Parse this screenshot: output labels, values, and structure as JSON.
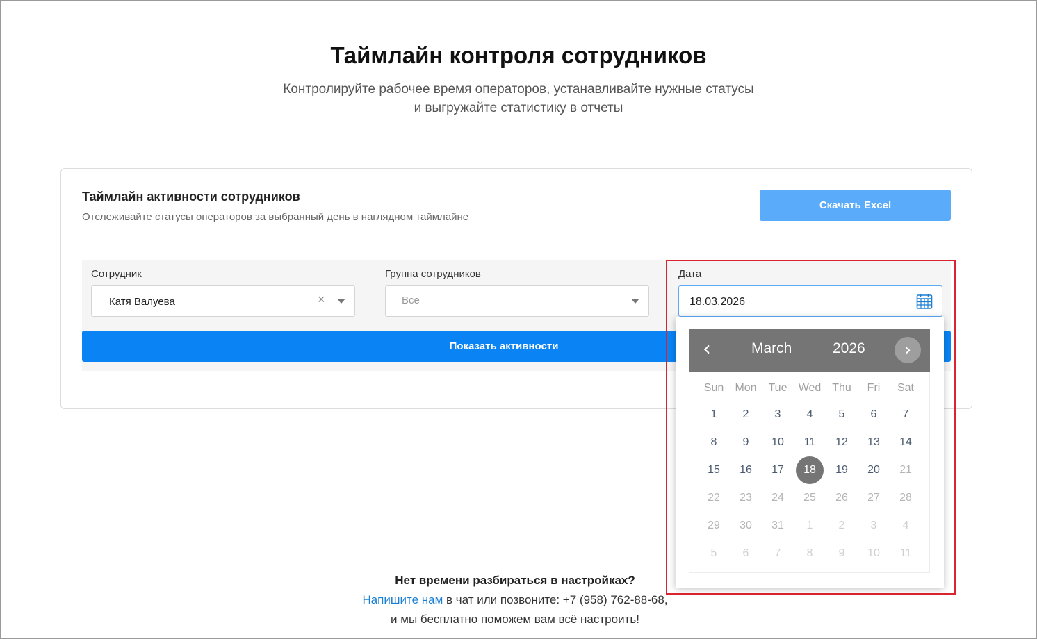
{
  "header": {
    "title": "Таймлайн контроля сотрудников",
    "subtitle_line1": "Контролируйте рабочее время операторов, устанавливайте нужные статусы",
    "subtitle_line2": "и выгружайте статистику в отчеты"
  },
  "card": {
    "title": "Таймлайн активности сотрудников",
    "description": "Отслеживайте статусы операторов за выбранный день в наглядном таймлайне",
    "excel_button": "Скачать Excel",
    "show_button": "Показать активности"
  },
  "filters": {
    "employee_label": "Сотрудник",
    "employee_value": "Катя Валуева",
    "clear_glyph": "×",
    "group_label": "Группа сотрудников",
    "group_value": "Все",
    "date_label": "Дата",
    "date_value": "18.03.2026"
  },
  "datepicker": {
    "prev_glyph": "‹",
    "next_glyph": "›",
    "month": "March",
    "year": "2026",
    "weekdays": [
      "Sun",
      "Mon",
      "Tue",
      "Wed",
      "Thu",
      "Fri",
      "Sat"
    ],
    "selected_day": 18,
    "days": [
      [
        {
          "d": "1",
          "s": "past"
        },
        {
          "d": "2",
          "s": "past"
        },
        {
          "d": "3",
          "s": "past"
        },
        {
          "d": "4",
          "s": "past"
        },
        {
          "d": "5",
          "s": "past"
        },
        {
          "d": "6",
          "s": "past"
        },
        {
          "d": "7",
          "s": "past"
        }
      ],
      [
        {
          "d": "8",
          "s": "past"
        },
        {
          "d": "9",
          "s": "past"
        },
        {
          "d": "10",
          "s": "past"
        },
        {
          "d": "11",
          "s": "past"
        },
        {
          "d": "12",
          "s": "past"
        },
        {
          "d": "13",
          "s": "past"
        },
        {
          "d": "14",
          "s": "past"
        }
      ],
      [
        {
          "d": "15",
          "s": "past"
        },
        {
          "d": "16",
          "s": "past"
        },
        {
          "d": "17",
          "s": "past"
        },
        {
          "d": "18",
          "s": "selected"
        },
        {
          "d": "19",
          "s": "past"
        },
        {
          "d": "20",
          "s": "past"
        },
        {
          "d": "21",
          "s": "future"
        }
      ],
      [
        {
          "d": "22",
          "s": "future"
        },
        {
          "d": "23",
          "s": "future"
        },
        {
          "d": "24",
          "s": "future"
        },
        {
          "d": "25",
          "s": "future"
        },
        {
          "d": "26",
          "s": "future"
        },
        {
          "d": "27",
          "s": "future"
        },
        {
          "d": "28",
          "s": "future"
        }
      ],
      [
        {
          "d": "29",
          "s": "future"
        },
        {
          "d": "30",
          "s": "future"
        },
        {
          "d": "31",
          "s": "future"
        },
        {
          "d": "1",
          "s": "other"
        },
        {
          "d": "2",
          "s": "other"
        },
        {
          "d": "3",
          "s": "other"
        },
        {
          "d": "4",
          "s": "other"
        }
      ],
      [
        {
          "d": "5",
          "s": "other"
        },
        {
          "d": "6",
          "s": "other"
        },
        {
          "d": "7",
          "s": "other"
        },
        {
          "d": "8",
          "s": "other"
        },
        {
          "d": "9",
          "s": "other"
        },
        {
          "d": "10",
          "s": "other"
        },
        {
          "d": "11",
          "s": "other"
        }
      ]
    ]
  },
  "footer": {
    "question": "Нет времени разбираться в настройках?",
    "link_text": "Напишите нам",
    "line2_rest": " в чат или позвоните: +7 (958) 762-88-68,",
    "line3": "и мы бесплатно поможем вам всё настроить!"
  },
  "colors": {
    "primary": "#0a84f5",
    "excel": "#5aabfa",
    "datepicker_header": "#757575",
    "highlight": "#d9232e"
  }
}
